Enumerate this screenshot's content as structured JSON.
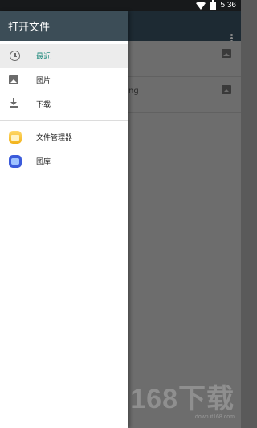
{
  "status_bar": {
    "time": "5:36",
    "wifi_icon": "wifi-icon",
    "battery_icon": "battery-icon"
  },
  "drawer": {
    "title": "打开文件",
    "items": [
      {
        "label": "最近",
        "icon": "clock-icon",
        "selected": true
      },
      {
        "label": "图片",
        "icon": "image-icon",
        "selected": false
      },
      {
        "label": "下载",
        "icon": "download-icon",
        "selected": false
      }
    ],
    "apps": [
      {
        "label": "文件管理器",
        "icon": "file-manager-icon"
      },
      {
        "label": "图库",
        "icon": "gallery-icon"
      }
    ]
  },
  "background": {
    "row_partial_text": "ng",
    "watermark": "168下载",
    "watermark_url": "down.it168.com"
  },
  "colors": {
    "accent": "#1e8a7c",
    "header": "#3c4d57"
  }
}
